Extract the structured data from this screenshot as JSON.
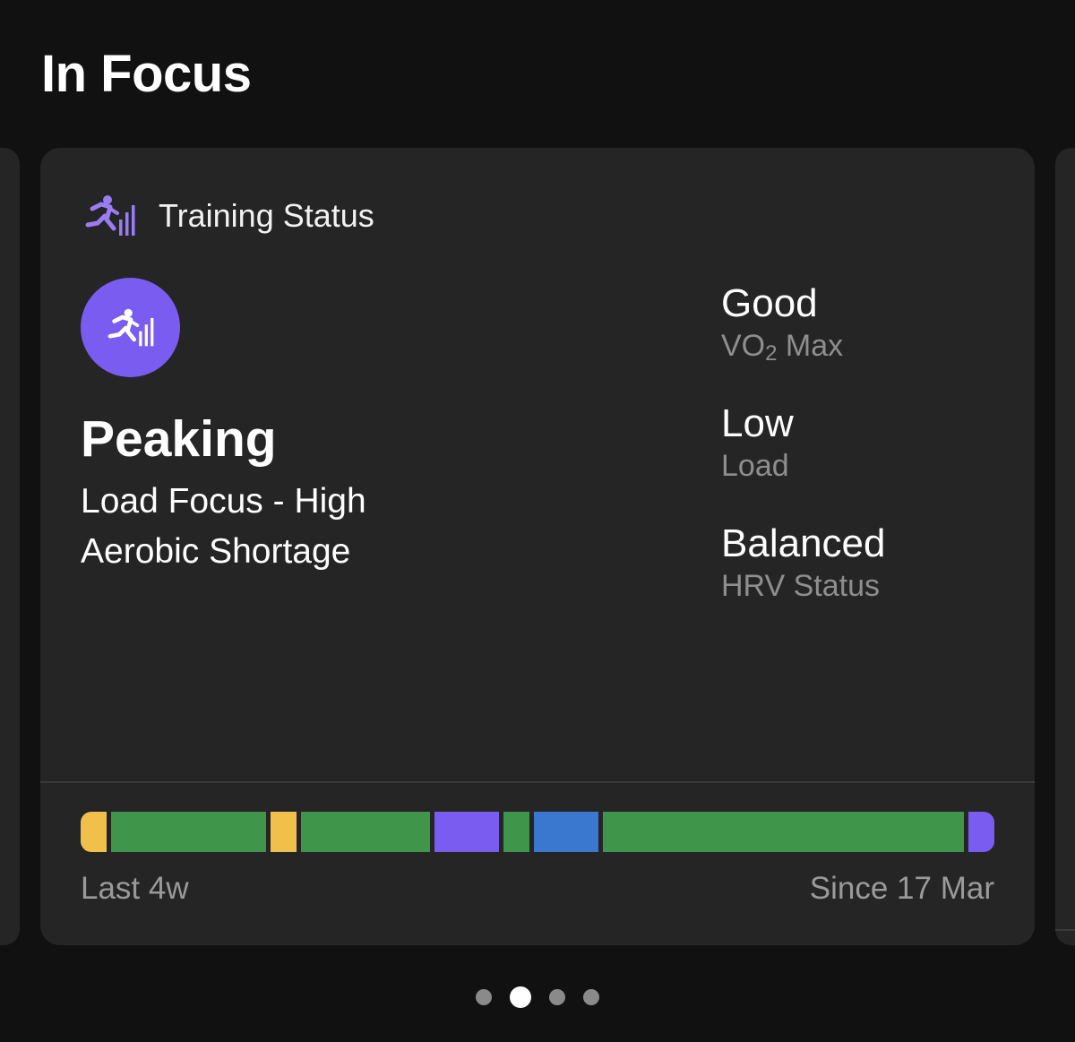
{
  "page": {
    "section_title": "In Focus"
  },
  "card": {
    "title": "Training Status",
    "icon": "training-status-icon",
    "accent_color": "#7b5cf0",
    "status": {
      "name": "Peaking",
      "lines": [
        "Load Focus - High",
        "Aerobic Shortage"
      ]
    },
    "metrics": [
      {
        "value": "Good",
        "label_prefix": "VO",
        "label_subscript": "2",
        "label_suffix": " Max"
      },
      {
        "value": "Low",
        "label": "Load"
      },
      {
        "value": "Balanced",
        "label": "HRV Status"
      }
    ],
    "history": {
      "start_label": "Last 4w",
      "end_label": "Since 17 Mar",
      "segments": [
        {
          "status": "yellow",
          "color": "#f0c04a",
          "days": 1
        },
        {
          "status": "green",
          "color": "#3f954a",
          "days": 6
        },
        {
          "status": "yellow",
          "color": "#f0c04a",
          "days": 1
        },
        {
          "status": "green",
          "color": "#3f954a",
          "days": 5
        },
        {
          "status": "purple",
          "color": "#7b5cf0",
          "days": 2.5
        },
        {
          "status": "green",
          "color": "#3f954a",
          "days": 1
        },
        {
          "status": "blue",
          "color": "#3a78d0",
          "days": 2.5
        },
        {
          "status": "green",
          "color": "#3f954a",
          "days": 14
        },
        {
          "status": "purple",
          "color": "#7b5cf0",
          "days": 1
        }
      ]
    }
  },
  "pager": {
    "count": 4,
    "active_index": 1
  }
}
